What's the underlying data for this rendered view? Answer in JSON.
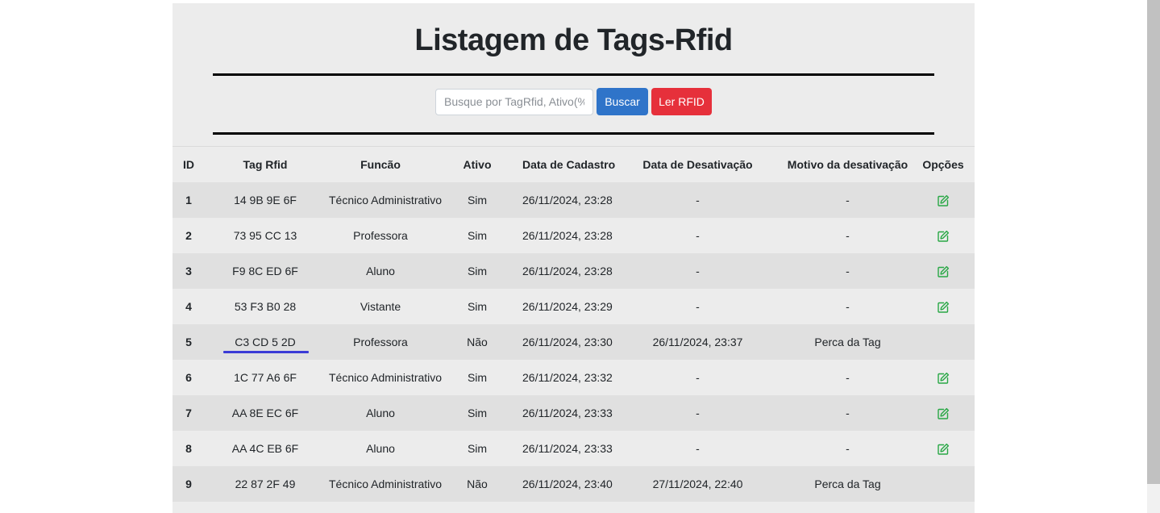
{
  "page": {
    "title": "Listagem de Tags-Rfid"
  },
  "search": {
    "placeholder": "Busque por TagRfid, Ativo(%a",
    "value": "",
    "search_label": "Buscar",
    "read_label": "Ler RFID"
  },
  "colors": {
    "primary": "#2f74c9",
    "danger": "#e6303b",
    "edit_icon": "#28a745",
    "underline": "#3b3bd6"
  },
  "table": {
    "headers": {
      "id": "ID",
      "tag": "Tag Rfid",
      "funcao": "Funcão",
      "ativo": "Ativo",
      "cadastro": "Data de Cadastro",
      "desativacao": "Data de Desativação",
      "motivo": "Motivo da desativação",
      "opcoes": "Opções"
    },
    "rows": [
      {
        "id": "1",
        "tag": "14 9B 9E 6F",
        "funcao": "Técnico Administrativo",
        "ativo": "Sim",
        "cadastro": "26/11/2024, 23:28",
        "desativacao": "-",
        "motivo": "-",
        "editable": true
      },
      {
        "id": "2",
        "tag": "73 95 CC 13",
        "funcao": "Professora",
        "ativo": "Sim",
        "cadastro": "26/11/2024, 23:28",
        "desativacao": "-",
        "motivo": "-",
        "editable": true
      },
      {
        "id": "3",
        "tag": "F9 8C ED 6F",
        "funcao": "Aluno",
        "ativo": "Sim",
        "cadastro": "26/11/2024, 23:28",
        "desativacao": "-",
        "motivo": "-",
        "editable": true
      },
      {
        "id": "4",
        "tag": "53 F3 B0 28",
        "funcao": "Vistante",
        "ativo": "Sim",
        "cadastro": "26/11/2024, 23:29",
        "desativacao": "-",
        "motivo": "-",
        "editable": true
      },
      {
        "id": "5",
        "tag": "C3 CD 5 2D",
        "funcao": "Professora",
        "ativo": "Não",
        "cadastro": "26/11/2024, 23:30",
        "desativacao": "26/11/2024, 23:37",
        "motivo": "Perca da Tag",
        "editable": false
      },
      {
        "id": "6",
        "tag": "1C 77 A6 6F",
        "funcao": "Técnico Administrativo",
        "ativo": "Sim",
        "cadastro": "26/11/2024, 23:32",
        "desativacao": "-",
        "motivo": "-",
        "editable": true
      },
      {
        "id": "7",
        "tag": "AA 8E EC 6F",
        "funcao": "Aluno",
        "ativo": "Sim",
        "cadastro": "26/11/2024, 23:33",
        "desativacao": "-",
        "motivo": "-",
        "editable": true
      },
      {
        "id": "8",
        "tag": "AA 4C EB 6F",
        "funcao": "Aluno",
        "ativo": "Sim",
        "cadastro": "26/11/2024, 23:33",
        "desativacao": "-",
        "motivo": "-",
        "editable": true
      },
      {
        "id": "9",
        "tag": "22 87 2F 49",
        "funcao": "Técnico Administrativo",
        "ativo": "Não",
        "cadastro": "26/11/2024, 23:40",
        "desativacao": "27/11/2024, 22:40",
        "motivo": "Perca da Tag",
        "editable": false
      }
    ]
  }
}
